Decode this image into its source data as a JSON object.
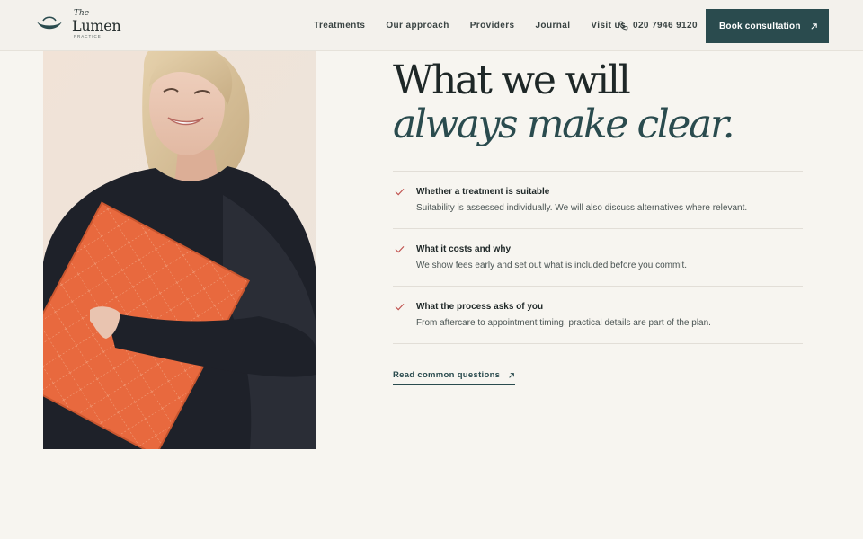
{
  "brand": {
    "prefix": "The",
    "name": "Lumen",
    "sub": "PRACTICE",
    "logo_icon": "crescent-eye-icon"
  },
  "nav": {
    "items": [
      "Treatments",
      "Our approach",
      "Providers",
      "Journal",
      "Visit us"
    ],
    "phone": "020 7946 9120",
    "phone_icon": "phone-icon",
    "cta_label": "Book consultation",
    "cta_icon": "arrow-up-right-icon"
  },
  "heading": {
    "line1": "What we will",
    "line2": "always make clear."
  },
  "commitments": [
    {
      "title": "Whether a treatment is suitable",
      "description": "Suitability is assessed individually. We will also discuss alternatives where relevant."
    },
    {
      "title": "What it costs and why",
      "description": "We show fees early and set out what is included before you commit."
    },
    {
      "title": "What the process asks of you",
      "description": "From aftercare to appointment timing, practical details are part of the plan."
    }
  ],
  "link": {
    "label": "Read common questions",
    "icon": "arrow-up-right-icon"
  },
  "colors": {
    "accent": "#2a4b4e",
    "check": "#c0524f",
    "background": "#f7f5f0"
  }
}
